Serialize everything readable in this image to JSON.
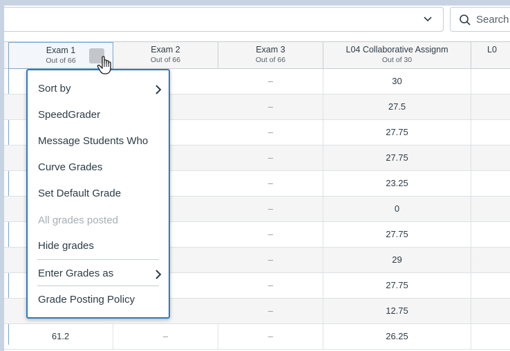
{
  "toolbar": {
    "search_placeholder": "Search"
  },
  "columns": [
    {
      "title": "Exam 1",
      "subtitle": "Out of 66"
    },
    {
      "title": "Exam 2",
      "subtitle": "Out of 66"
    },
    {
      "title": "Exam 3",
      "subtitle": "Out of 66"
    },
    {
      "title": "L04 Collaborative Assignm",
      "subtitle": "Out of 30"
    },
    {
      "title": "L0",
      "subtitle": ""
    }
  ],
  "rows": [
    {
      "exam3": "–",
      "l04": "30"
    },
    {
      "exam3": "–",
      "l04": "27.5"
    },
    {
      "exam3": "–",
      "l04": "27.75"
    },
    {
      "exam3": "–",
      "l04": "27.75"
    },
    {
      "exam3": "–",
      "l04": "23.25"
    },
    {
      "exam3": "–",
      "l04": "0"
    },
    {
      "exam3": "–",
      "l04": "27.75"
    },
    {
      "exam3": "–",
      "l04": "29"
    },
    {
      "exam3": "–",
      "l04": "27.75"
    },
    {
      "exam3": "–",
      "l04": "12.75"
    },
    {
      "exam1": "61.2",
      "exam2": "–",
      "exam3": "–",
      "l04": "26.25"
    }
  ],
  "menu": {
    "items": [
      {
        "label": "Sort by",
        "submenu": true
      },
      {
        "label": "SpeedGrader"
      },
      {
        "label": "Message Students Who"
      },
      {
        "label": "Curve Grades"
      },
      {
        "label": "Set Default Grade"
      },
      {
        "label": "All grades posted",
        "disabled": true
      },
      {
        "label": "Hide grades"
      },
      {
        "label": "Enter Grades as",
        "submenu": true
      },
      {
        "label": "Grade Posting Policy"
      }
    ]
  },
  "colors": {
    "accent": "#2c7ac0",
    "background": "#c7d3e3"
  }
}
